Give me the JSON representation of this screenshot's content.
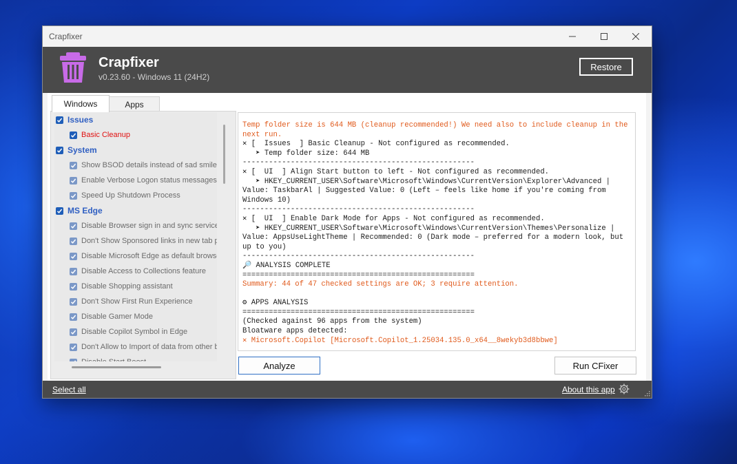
{
  "window": {
    "title": "Crapfixer"
  },
  "header": {
    "app_name": "Crapfixer",
    "version": "v0.23.60 - Windows 11 (24H2)",
    "restore_label": "Restore"
  },
  "tabs": [
    {
      "label": "Windows"
    },
    {
      "label": "Apps"
    }
  ],
  "settings_list": [
    {
      "type": "group",
      "label": "Issues"
    },
    {
      "type": "item",
      "label": "Basic Cleanup",
      "style": "alert"
    },
    {
      "type": "group",
      "label": "System"
    },
    {
      "type": "item",
      "label": "Show BSOD details instead of sad smiley"
    },
    {
      "type": "item",
      "label": "Enable Verbose Logon status messages"
    },
    {
      "type": "item",
      "label": "Speed Up Shutdown Process"
    },
    {
      "type": "group",
      "label": "MS Edge"
    },
    {
      "type": "item",
      "label": "Disable Browser sign in and sync services"
    },
    {
      "type": "item",
      "label": "Don't Show Sponsored links in new tab page"
    },
    {
      "type": "item",
      "label": "Disable Microsoft Edge as default browser"
    },
    {
      "type": "item",
      "label": "Disable Access to Collections feature"
    },
    {
      "type": "item",
      "label": "Disable Shopping assistant"
    },
    {
      "type": "item",
      "label": "Don't Show First Run Experience"
    },
    {
      "type": "item",
      "label": "Disable Gamer Mode"
    },
    {
      "type": "item",
      "label": "Disable Copilot Symbol in Edge"
    },
    {
      "type": "item",
      "label": "Don't Allow to Import of data from other b"
    },
    {
      "type": "item",
      "label": "Disable Start Boost"
    }
  ],
  "log_lines": [
    {
      "text": "Temp folder size is 644 MB (cleanup recommended!) We need also to include cleanup in the next run.",
      "color": "orange"
    },
    {
      "text": "✕ [  Issues  ] Basic Cleanup - Not configured as recommended."
    },
    {
      "text": "   ➤ Temp folder size: 644 MB"
    },
    {
      "text": "-----------------------------------------------------"
    },
    {
      "text": "✕ [  UI  ] Align Start button to left - Not configured as recommended."
    },
    {
      "text": "   ➤ HKEY_CURRENT_USER\\Software\\Microsoft\\Windows\\CurrentVersion\\Explorer\\Advanced | Value: TaskbarAl | Suggested Value: 0 (Left – feels like home if you're coming from Windows 10)"
    },
    {
      "text": "-----------------------------------------------------"
    },
    {
      "text": "✕ [  UI  ] Enable Dark Mode for Apps - Not configured as recommended."
    },
    {
      "text": "   ➤ HKEY_CURRENT_USER\\Software\\Microsoft\\Windows\\CurrentVersion\\Themes\\Personalize | Value: AppsUseLightTheme | Recommended: 0 (Dark mode – preferred for a modern look, but up to you)"
    },
    {
      "text": "-----------------------------------------------------"
    },
    {
      "text": "🔎 ANALYSIS COMPLETE"
    },
    {
      "text": "====================================================="
    },
    {
      "text": "Summary: 44 of 47 checked settings are OK; 3 require attention.",
      "color": "orange"
    },
    {
      "text": " "
    },
    {
      "text": "⚙ APPS ANALYSIS"
    },
    {
      "text": "====================================================="
    },
    {
      "text": "(Checked against 96 apps from the system)"
    },
    {
      "text": "Bloatware apps detected:"
    },
    {
      "text": "✕ Microsoft.Copilot [Microsoft.Copilot_1.25034.135.0_x64__8wekyb3d8bbwe]",
      "color": "orange"
    }
  ],
  "buttons": {
    "analyze": "Analyze",
    "run": "Run CFixer"
  },
  "footer": {
    "select_all": "Select all",
    "about": "About this app"
  },
  "colors": {
    "accent": "#1f5eb8",
    "group_text": "#2f5fc2",
    "alert": "#e01010",
    "log_warning": "#e05a1c",
    "header_bg": "#4a4a4a",
    "logo": "#c86be8"
  },
  "icons": {
    "logo": "trash-bin-icon",
    "settings": "gear-icon",
    "resize": "size-grip-icon"
  }
}
